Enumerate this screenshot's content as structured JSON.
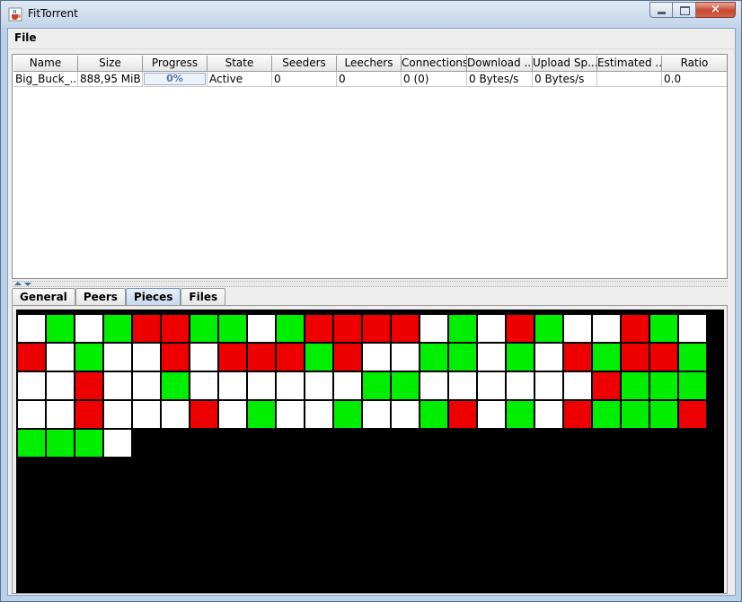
{
  "window": {
    "title": "FitTorrent",
    "close_glyph": "×",
    "icon": "java-coffee-cup-icon"
  },
  "menu": {
    "file": "File"
  },
  "table": {
    "columns": [
      "Name",
      "Size",
      "Progress",
      "State",
      "Seeders",
      "Leechers",
      "Connections",
      "Download ...",
      "Upload Sp...",
      "Estimated ...",
      "Ratio"
    ],
    "rows": [
      {
        "name": "Big_Buck_...",
        "size": "888,95 MiB",
        "progress": "0%",
        "state": "Active",
        "seeders": "0",
        "leechers": "0",
        "connections": "0 (0)",
        "download": "0 Bytes/s",
        "upload": "0 Bytes/s",
        "estimated": "",
        "ratio": "0.0"
      }
    ]
  },
  "tabs": [
    "General",
    "Peers",
    "Pieces",
    "Files"
  ],
  "active_tab": "Pieces",
  "piece_colors": {
    "W": "#ffffff",
    "G": "#00ee00",
    "R": "#ee0000"
  },
  "pieces_rows": [
    "WGWGRRGGWGRRRRWGWRGWWRGW",
    "RWGWWRWRRRGRWWGGWGWRGRRG",
    "WWRWWGWWWWWWGGWWWWWWRGGG",
    "WWRWWWRWGWWGWWGRWGWRGGGR",
    "GGGW"
  ]
}
